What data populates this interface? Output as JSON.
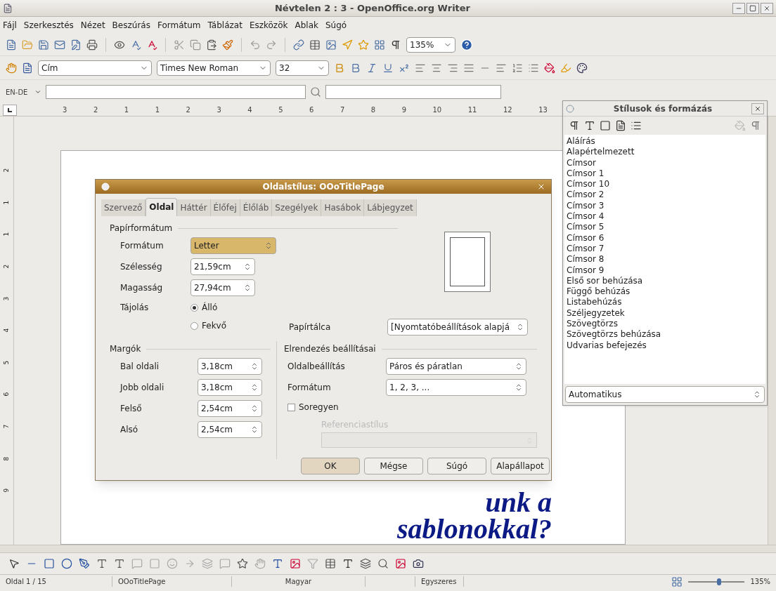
{
  "window": {
    "title": "Névtelen 2 : 3 - OpenOffice.org Writer"
  },
  "menu": [
    "Fájl",
    "Szerkesztés",
    "Nézet",
    "Beszúrás",
    "Formátum",
    "Táblázat",
    "Eszközök",
    "Ablak",
    "Súgó"
  ],
  "standard_toolbar": {
    "zoom": "135%"
  },
  "formatting_toolbar": {
    "paragraph_style": "Cím",
    "font_name": "Times New Roman",
    "font_size": "32"
  },
  "find_toolbar": {
    "language": "EN-DE"
  },
  "ruler": {
    "labels": [
      "3",
      "2",
      "1",
      "1",
      "2",
      "3",
      "4",
      "5",
      "6",
      "7",
      "8",
      "9",
      "10",
      "11",
      "12",
      "13"
    ]
  },
  "vertical_ruler": {
    "labels": [
      "2",
      "1",
      "1",
      "2",
      "3",
      "4",
      "5",
      "6",
      "7",
      "8",
      "9"
    ]
  },
  "document": {
    "heading_lines": [
      "unk a",
      "sablonokkal?"
    ]
  },
  "page_style_dialog": {
    "title": "Oldalstílus: OOoTitlePage",
    "tabs": [
      {
        "label": "Szervező",
        "selected": false
      },
      {
        "label": "Oldal",
        "selected": true
      },
      {
        "label": "Háttér",
        "selected": false
      },
      {
        "label": "Élőfej",
        "selected": false
      },
      {
        "label": "Élőláb",
        "selected": false
      },
      {
        "label": "Szegélyek",
        "selected": false
      },
      {
        "label": "Hasábok",
        "selected": false
      },
      {
        "label": "Lábjegyzet",
        "selected": false
      }
    ],
    "paper_format": {
      "heading": "Papírformátum",
      "format": {
        "label": "Formátum",
        "value": "Letter"
      },
      "width": {
        "label": "Szélesség",
        "value": "21,59cm"
      },
      "height": {
        "label": "Magasság",
        "value": "27,94cm"
      },
      "orientation": {
        "label": "Tájolás",
        "options": [
          {
            "label": "Álló",
            "selected": true
          },
          {
            "label": "Fekvő",
            "selected": false
          }
        ]
      },
      "paper_tray": {
        "label": "Papírtálca",
        "value": "[Nyomtatóbeállítások alapjá"
      }
    },
    "margins": {
      "heading": "Margók",
      "fields": [
        {
          "label": "Bal oldali",
          "value": "3,18cm"
        },
        {
          "label": "Jobb oldali",
          "value": "3,18cm"
        },
        {
          "label": "Felső",
          "value": "2,54cm"
        },
        {
          "label": "Alsó",
          "value": "2,54cm"
        }
      ]
    },
    "layout": {
      "heading": "Elrendezés beállításai",
      "page_layout": {
        "label": "Oldalbeállítás",
        "value": "Páros és páratlan"
      },
      "numbering": {
        "label": "Formátum",
        "value": "1, 2, 3, ..."
      },
      "register_true": {
        "label": "Soregyen",
        "checked": false
      },
      "reference_style": {
        "label": "Referenciastílus",
        "disabled": true
      }
    },
    "buttons": [
      "OK",
      "Mégse",
      "Súgó",
      "Alapállapot"
    ]
  },
  "styles_panel": {
    "title": "Stílusok és formázás",
    "items": [
      "Aláírás",
      "Alapértelmezett",
      "Címsor",
      "Címsor 1",
      "Címsor 10",
      "Címsor 2",
      "Címsor 3",
      "Címsor 4",
      "Címsor 5",
      "Címsor 6",
      "Címsor 7",
      "Címsor 8",
      "Címsor 9",
      "Első sor behúzása",
      "Függő behúzás",
      "Listabehúzás",
      "Széljegyzetek",
      "Szövegtörzs",
      "Szövegtörzs behúzása",
      "Udvarias befejezés"
    ],
    "filter": "Automatikus"
  },
  "status_bar": {
    "page": "Oldal 1 / 15",
    "page_style": "OOoTitlePage",
    "language": "Magyar",
    "selection_mode": "Egyszeres",
    "zoom_slider": {
      "level": 0.55
    },
    "zoom": "135%"
  }
}
